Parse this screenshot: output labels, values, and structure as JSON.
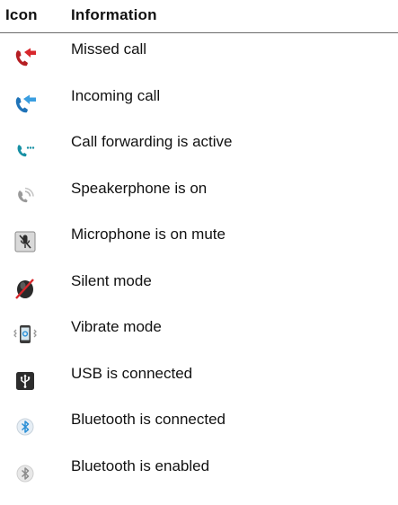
{
  "table": {
    "header": {
      "icon": "Icon",
      "information": "Information"
    },
    "rows": [
      {
        "icon": "missed-call-icon",
        "label": "Missed call"
      },
      {
        "icon": "incoming-call-icon",
        "label": "Incoming call"
      },
      {
        "icon": "call-forwarding-icon",
        "label": "Call forwarding is active"
      },
      {
        "icon": "speakerphone-icon",
        "label": "Speakerphone is on"
      },
      {
        "icon": "microphone-mute-icon",
        "label": "Microphone is on mute"
      },
      {
        "icon": "silent-mode-icon",
        "label": "Silent mode"
      },
      {
        "icon": "vibrate-mode-icon",
        "label": "Vibrate mode"
      },
      {
        "icon": "usb-connected-icon",
        "label": "USB is connected"
      },
      {
        "icon": "bluetooth-connected-icon",
        "label": "Bluetooth is connected"
      },
      {
        "icon": "bluetooth-enabled-icon",
        "label": "Bluetooth is enabled"
      }
    ]
  },
  "colors": {
    "missed_red": "#d8262b",
    "incoming_blue": "#2a8fd6",
    "forward_teal": "#1790a4",
    "gray_icon": "#9a9a9a",
    "dark_icon": "#2d2d2d",
    "rule": "#6b6b6b"
  }
}
